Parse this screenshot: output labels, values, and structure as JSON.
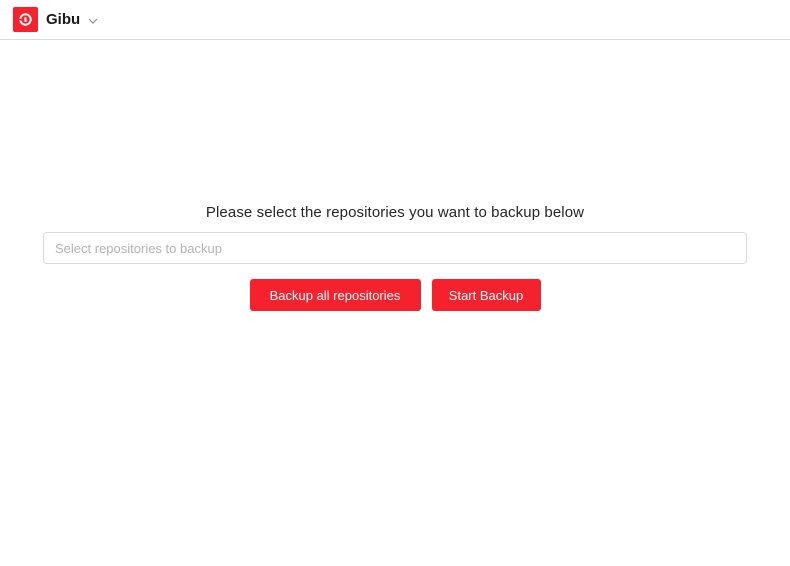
{
  "header": {
    "app_name": "Gibu",
    "logo_icon": "gibu-logo-icon",
    "dropdown_icon": "chevron-down-icon"
  },
  "main": {
    "prompt": "Please select the repositories you want to backup below",
    "repo_select": {
      "placeholder": "Select repositories to backup",
      "value": ""
    },
    "buttons": {
      "backup_all_label": "Backup all repositories",
      "start_backup_label": "Start Backup"
    }
  },
  "colors": {
    "accent": "#f5222d",
    "border": "#d9d9d9",
    "placeholder": "#b3b3b3"
  }
}
